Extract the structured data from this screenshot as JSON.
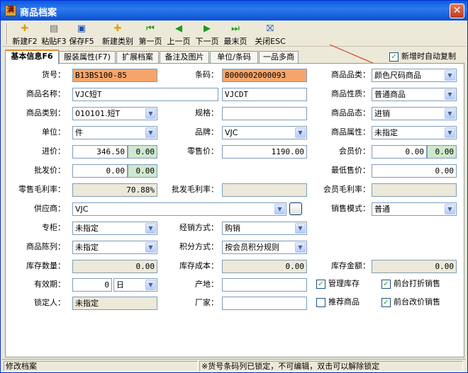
{
  "window": {
    "title": "商品档案",
    "app_icon_glyph": "满"
  },
  "toolbar": {
    "new": "新建F2",
    "paste": "粘贴F3",
    "save": "保存F5",
    "new_category": "新建类别",
    "first": "第一页",
    "prev": "上一页",
    "next": "下一页",
    "last": "最末页",
    "close": "关闭ESC"
  },
  "tabs": [
    "基本信息F6",
    "服装属性(F7)",
    "扩展档案",
    "备注及图片",
    "单位/条码",
    "一品多商"
  ],
  "auto_copy": {
    "label": "新增时自动复制",
    "checked": true
  },
  "fields": {
    "huohao": {
      "label": "货号：",
      "value": "B13BS100-85"
    },
    "tiaoma": {
      "label": "条码：",
      "value": "8000002000093"
    },
    "pinlei": {
      "label": "商品品类：",
      "value": "颜色尺码商品"
    },
    "name": {
      "label": "商品名称：",
      "value": "VJC短T",
      "value2": "VJCDT"
    },
    "xingzhi": {
      "label": "商品性质：",
      "value": "普通商品"
    },
    "leibie": {
      "label": "商品类别：",
      "value": "010101.短T"
    },
    "guige": {
      "label": "规格：",
      "value": ""
    },
    "pintai": {
      "label": "商品品态：",
      "value": "进销"
    },
    "danwei": {
      "label": "单位：",
      "value": "件"
    },
    "pinpai": {
      "label": "品牌：",
      "value": "VJC"
    },
    "shuxing": {
      "label": "商品属性：",
      "value": "未指定"
    },
    "jinjia": {
      "label": "进价：",
      "value": "346.50",
      "extra": "0.00"
    },
    "lingshou": {
      "label": "零售价：",
      "value": "1190.00"
    },
    "huiyuan": {
      "label": "会员价：",
      "value": "0.00",
      "extra": "0.00"
    },
    "pifa": {
      "label": "批发价：",
      "value": "0.00",
      "extra": "0.00"
    },
    "zuidi": {
      "label": "最低售价：",
      "value": "0.00"
    },
    "lingshou_mll": {
      "label": "零售毛利率：",
      "value": "70.88%"
    },
    "pifa_mll": {
      "label": "批发毛利率：",
      "value": ""
    },
    "huiyuan_mll": {
      "label": "会员毛利率：",
      "value": ""
    },
    "gongying": {
      "label": "供应商：",
      "value": "VJC"
    },
    "xiaoshou_ms": {
      "label": "销售模式：",
      "value": "普通"
    },
    "zhuangui": {
      "label": "专柜：",
      "value": "未指定"
    },
    "jingxiao": {
      "label": "经销方式：",
      "value": "购销"
    },
    "chenlie": {
      "label": "商品陈列：",
      "value": "未指定"
    },
    "jifen": {
      "label": "积分方式：",
      "value": "按会员积分规则"
    },
    "kucun_sl": {
      "label": "库存数量：",
      "value": "0.00"
    },
    "kucun_cb": {
      "label": "库存成本：",
      "value": "0.00"
    },
    "kucun_je": {
      "label": "库存金额：",
      "value": "0.00"
    },
    "youxiao": {
      "label": "有效期：",
      "value": "0",
      "unit": "日"
    },
    "chandi": {
      "label": "产地：",
      "value": ""
    },
    "suoding": {
      "label": "锁定人：",
      "value": "未指定"
    },
    "changjia": {
      "label": "厂家：",
      "value": ""
    }
  },
  "checks": {
    "guanli": {
      "label": "管理库存",
      "checked": true
    },
    "dazhe": {
      "label": "前台打折销售",
      "checked": true
    },
    "tuijian": {
      "label": "推荐商品",
      "checked": false
    },
    "gaijia": {
      "label": "前台改价销售",
      "checked": true
    }
  },
  "status": {
    "left": "修改档案",
    "right": "※货号条码列已锁定，不可编辑，双击可以解除锁定"
  },
  "colors": {
    "locked_field": "#f5a56b",
    "readonly_field": "#ece9d8",
    "price_extra": "#cfe8cf",
    "annotation_arrow": "#d04020"
  }
}
